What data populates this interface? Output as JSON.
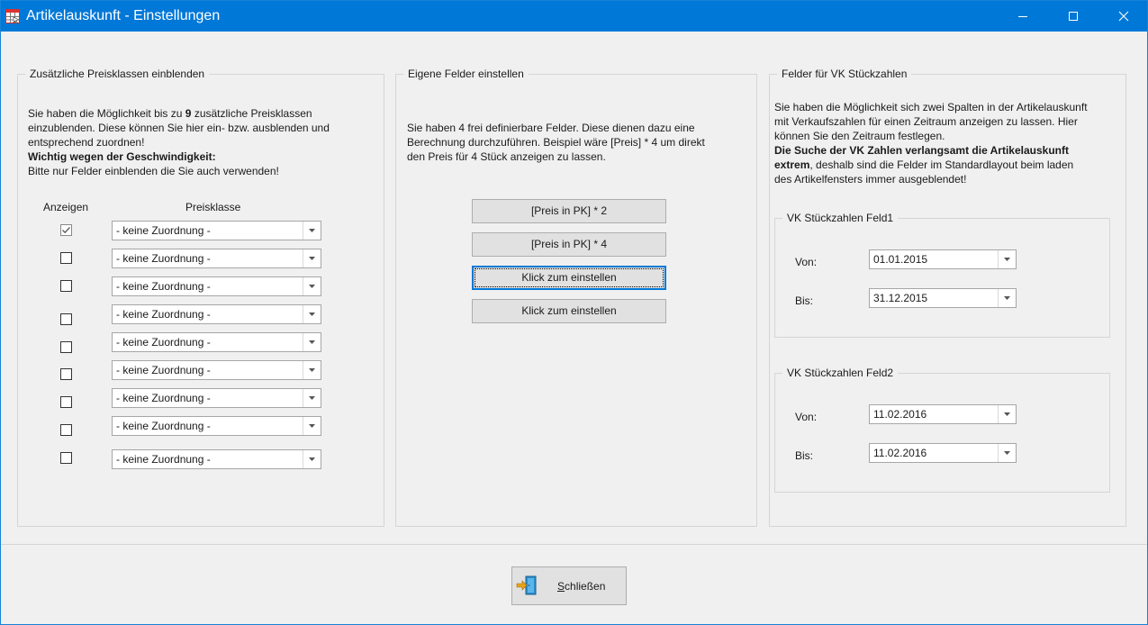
{
  "window": {
    "title": "Artikelauskunft - Einstellungen"
  },
  "group_preisklassen": {
    "legend": "Zusätzliche Preisklassen einblenden",
    "intro_1": "Sie haben die Möglichkeit bis zu",
    "intro_num": "9",
    "intro_2": "zusätzliche Preisklassen",
    "intro_line2": "einzublenden. Diese können Sie hier ein- bzw. ausblenden und",
    "intro_line3": "entsprechend zuordnen!",
    "warning_bold": "Wichtig wegen der Geschwindigkeit:",
    "warning_text": " Bitte nur Felder einblenden die Sie auch verwenden!",
    "col_show": "Anzeigen",
    "col_priceclass": "Preisklasse",
    "rows": [
      {
        "checked": true,
        "value": "- keine Zuordnung -"
      },
      {
        "checked": false,
        "value": "- keine Zuordnung -"
      },
      {
        "checked": false,
        "value": "- keine Zuordnung -"
      },
      {
        "checked": false,
        "value": "- keine Zuordnung -"
      },
      {
        "checked": false,
        "value": "- keine Zuordnung -"
      },
      {
        "checked": false,
        "value": "- keine Zuordnung -"
      },
      {
        "checked": false,
        "value": "- keine Zuordnung -"
      },
      {
        "checked": false,
        "value": "- keine Zuordnung -"
      },
      {
        "checked": false,
        "value": "- keine Zuordnung -"
      }
    ]
  },
  "group_eigene": {
    "legend": "Eigene Felder einstellen",
    "line1": "Sie haben 4 frei definierbare Felder. Diese dienen dazu eine",
    "line2": "Berechnung durchzuführen. Beispiel wäre [Preis] * 4 um direkt",
    "line3": "den Preis für 4 Stück anzeigen zu lassen.",
    "buttons": [
      "[Preis in PK] * 2",
      "[Preis in PK] * 4",
      "Klick zum einstellen",
      "Klick zum einstellen"
    ]
  },
  "group_vk": {
    "legend": "Felder für VK Stückzahlen",
    "line1": "Sie haben die Möglichkeit sich zwei Spalten in der Artikelauskunft",
    "line2": "mit Verkaufszahlen für einen Zeitraum anzeigen zu lassen. Hier",
    "line3": "können Sie den Zeitraum festlegen.",
    "bold_line1": "Die Suche der VK Zahlen verlangsamt die Artikelauskunft",
    "bold_line2": "extrem",
    "line5": ", deshalb sind die Felder im Standardlayout beim laden",
    "line6": "des Artikelfensters immer ausgeblendet!",
    "feld1": {
      "legend": "VK Stückzahlen Feld1",
      "from_label": "Von:",
      "from": "01.01.2015",
      "to_label": "Bis:",
      "to": "31.12.2015"
    },
    "feld2": {
      "legend": "VK Stückzahlen Feld2",
      "from_label": "Von:",
      "from": "11.02.2016",
      "to_label": "Bis:",
      "to": "11.02.2016"
    }
  },
  "footer": {
    "close_hotkey": "S",
    "close_rest": "chließen"
  },
  "colors": {
    "titlebar": "#0078d7",
    "focus": "#0078d7"
  }
}
